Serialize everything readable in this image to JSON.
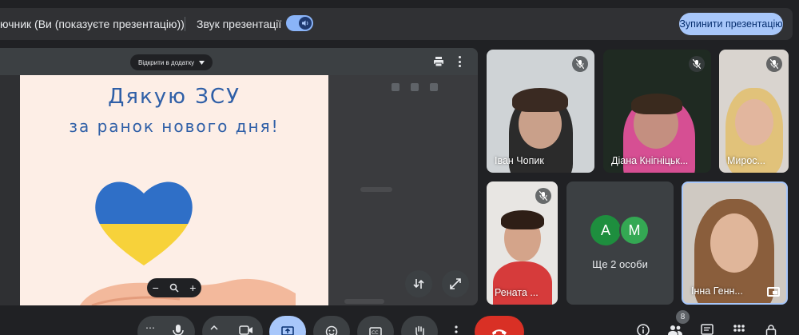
{
  "banner": {
    "presenter_text": "ючник (Ви (показуєте презентацію))",
    "audio_label": "Звук презентації",
    "stop_label": "Зупинити презентацію"
  },
  "presentation": {
    "open_in_app_label": "Відкрити в додатку",
    "slide_title_line1": "Дякую ЗСУ",
    "slide_title_line2": "за ранок нового дня!",
    "zoom_out": "−",
    "zoom_in": "+"
  },
  "participants": [
    {
      "name": "Іван Чопик",
      "mic_muted": true
    },
    {
      "name": "Діана Кнігніцьк...",
      "mic_muted": true
    },
    {
      "name": "Мирос...",
      "mic_muted": true
    },
    {
      "name": "Рената ...",
      "mic_muted": true
    },
    {
      "name": "Інна Генн...",
      "mic_muted": false
    }
  ],
  "more_people": {
    "label": "Ще 2 особи",
    "avatars": [
      {
        "letter": "А",
        "color": "#1e8e3e"
      },
      {
        "letter": "М",
        "color": "#34a853"
      }
    ]
  },
  "toolbar": {
    "participants_count": "8"
  },
  "colors": {
    "background": "#202124",
    "accent": "#a8c7fa",
    "end_call": "#d93025",
    "slide_text": "#2f5fa7"
  }
}
